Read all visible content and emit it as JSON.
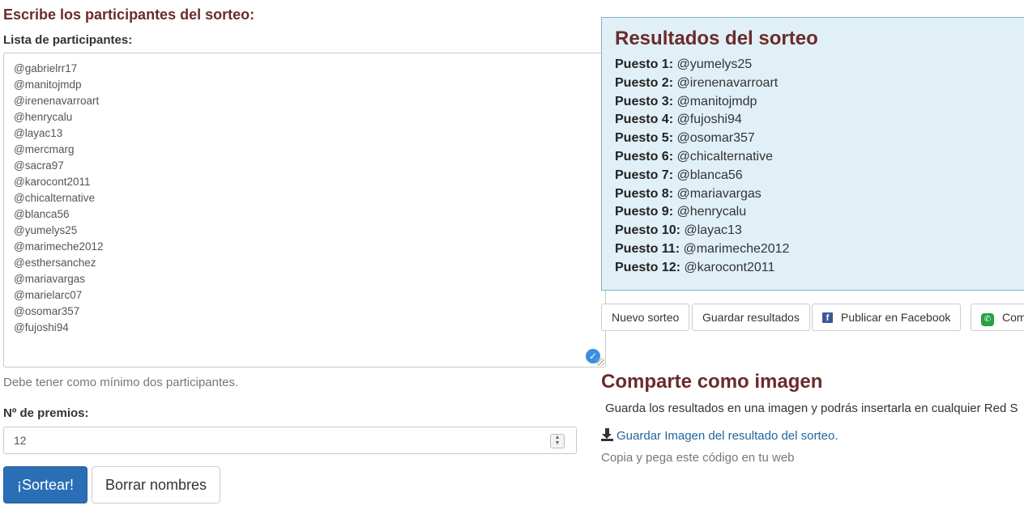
{
  "form": {
    "heading": "Escribe los participantes del sorteo:",
    "participants_label": "Lista de participantes:",
    "participants": [
      "@gabrielrr17",
      "@manitojmdp",
      "@irenenavarroart",
      "@henrycalu",
      "@layac13",
      "@mercmarg",
      "@sacra97",
      "@karocont2011",
      "@chicalternative",
      "@blanca56",
      "@yumelys25",
      "@marimeche2012",
      "@esthersanchez",
      "@mariavargas",
      "@marielarc07",
      "@osomar357",
      "@fujoshi94"
    ],
    "help_text": "Debe tener como mínimo dos participantes.",
    "prizes_label": "Nº de premios:",
    "prizes_value": "12",
    "draw_button": "¡Sortear!",
    "clear_button": "Borrar nombres"
  },
  "results": {
    "title": "Resultados del sorteo",
    "rows": [
      {
        "label": "Puesto 1:",
        "winner": "@yumelys25"
      },
      {
        "label": "Puesto 2:",
        "winner": "@irenenavarroart"
      },
      {
        "label": "Puesto 3:",
        "winner": "@manitojmdp"
      },
      {
        "label": "Puesto 4:",
        "winner": "@fujoshi94"
      },
      {
        "label": "Puesto 5:",
        "winner": "@osomar357"
      },
      {
        "label": "Puesto 6:",
        "winner": "@chicalternative"
      },
      {
        "label": "Puesto 7:",
        "winner": "@blanca56"
      },
      {
        "label": "Puesto 8:",
        "winner": "@mariavargas"
      },
      {
        "label": "Puesto 9:",
        "winner": "@henrycalu"
      },
      {
        "label": "Puesto 10:",
        "winner": "@layac13"
      },
      {
        "label": "Puesto 11:",
        "winner": "@marimeche2012"
      },
      {
        "label": "Puesto 12:",
        "winner": "@karocont2011"
      }
    ]
  },
  "actions": {
    "new_draw": "Nuevo sorteo",
    "save_results": "Guardar resultados",
    "publish_facebook": "Publicar en Facebook",
    "share_whatsapp": "Com"
  },
  "share": {
    "title": "Comparte como imagen",
    "description": "Guarda los resultados en una imagen y podrás insertarla en cualquier Red S",
    "download_link": "Guardar Imagen del resultado del sorteo.",
    "copy_text": "Copia y pega este código en tu web"
  },
  "icons": {
    "check": "check-icon",
    "facebook": "facebook-icon",
    "whatsapp": "whatsapp-icon",
    "download": "download-icon"
  },
  "colors": {
    "heading": "#6b2b2b",
    "primary_button": "#2a6fb6",
    "results_background": "#e1f0f7",
    "link": "#23669e"
  }
}
